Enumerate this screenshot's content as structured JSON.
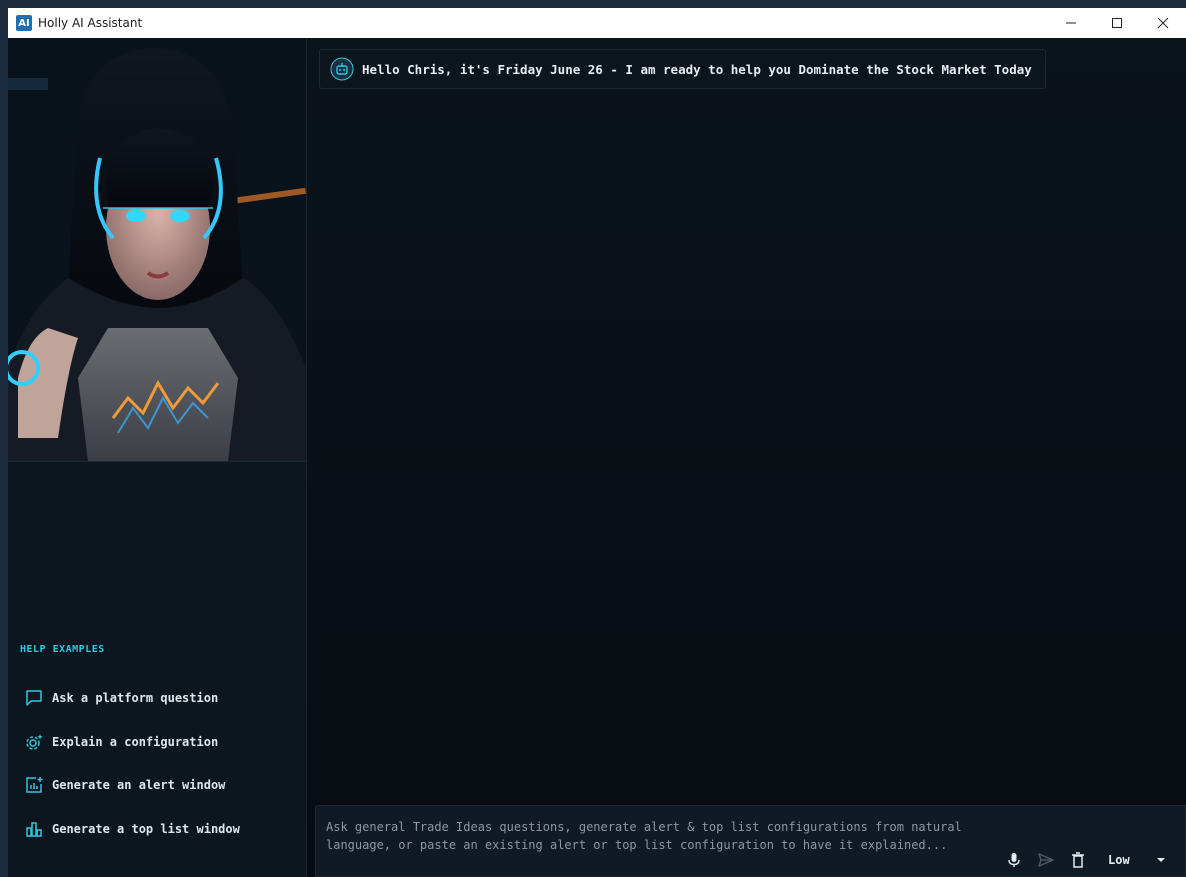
{
  "window": {
    "logo_text": "AI",
    "title": "Holly AI Assistant"
  },
  "sidebar": {
    "help_heading": "HELP EXAMPLES",
    "items": [
      {
        "label": "Ask a platform question",
        "icon": "chat-bubble-icon"
      },
      {
        "label": "Explain a configuration",
        "icon": "gear-sparkle-icon"
      },
      {
        "label": "Generate an alert window",
        "icon": "chart-add-icon"
      },
      {
        "label": "Generate a top list window",
        "icon": "bar-chart-icon"
      }
    ]
  },
  "chat": {
    "messages": [
      {
        "sender_icon": "robot-icon",
        "text": "Hello Chris, it's Friday June 26 - I am ready to help you Dominate the Stock Market Today"
      }
    ]
  },
  "composer": {
    "placeholder": "Ask general Trade Ideas questions, generate alert & top list configurations from natural language, or paste an existing alert or top list configuration to have it explained...",
    "level_value": "Low"
  },
  "colors": {
    "accent": "#31c7e0",
    "background": "#0b1118",
    "text": "#e6edf2"
  }
}
